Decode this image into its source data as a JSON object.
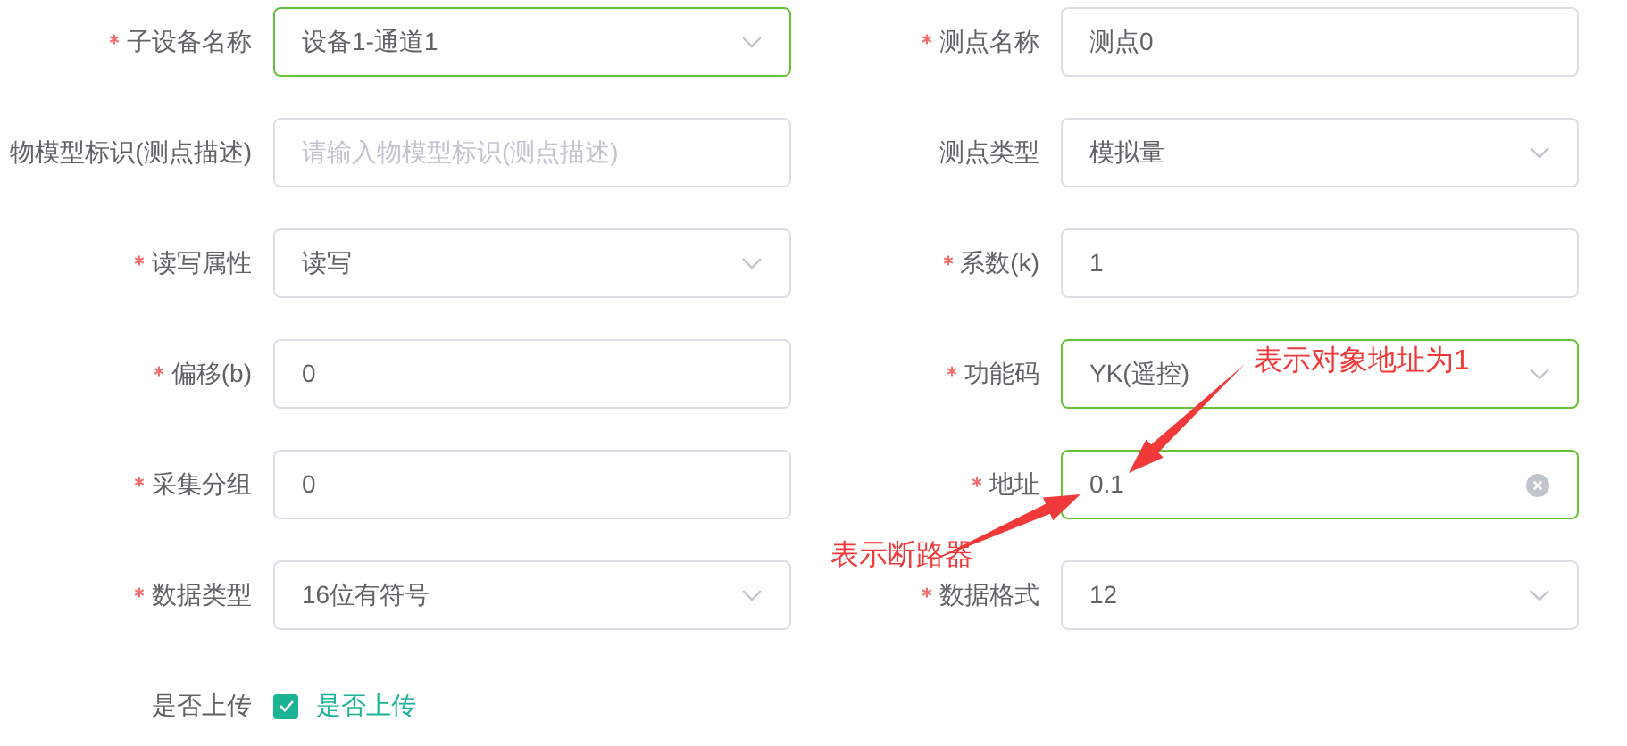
{
  "rows": [
    {
      "left": {
        "label": "子设备名称",
        "required": true,
        "kind": "select",
        "value": "设备1-通道1",
        "focused": true
      },
      "right": {
        "label": "测点名称",
        "required": true,
        "kind": "input",
        "value": "测点0",
        "focused": false
      }
    },
    {
      "left": {
        "label": "物模型标识(测点描述)",
        "required": false,
        "kind": "input",
        "placeholder": "请输入物模型标识(测点描述)",
        "focused": false
      },
      "right": {
        "label": "测点类型",
        "required": false,
        "kind": "select",
        "value": "模拟量",
        "focused": false
      }
    },
    {
      "left": {
        "label": "读写属性",
        "required": true,
        "kind": "select",
        "value": "读写",
        "focused": false
      },
      "right": {
        "label": "系数(k)",
        "required": true,
        "kind": "input",
        "value": "1",
        "focused": false
      }
    },
    {
      "left": {
        "label": "偏移(b)",
        "required": true,
        "kind": "input",
        "value": "0",
        "focused": false
      },
      "right": {
        "label": "功能码",
        "required": true,
        "kind": "select",
        "value": "YK(遥控)",
        "focused": true
      }
    },
    {
      "left": {
        "label": "采集分组",
        "required": true,
        "kind": "input",
        "value": "0",
        "focused": false
      },
      "right": {
        "label": "地址",
        "required": true,
        "kind": "clearable",
        "value": "0.1",
        "focused": true
      }
    },
    {
      "left": {
        "label": "数据类型",
        "required": true,
        "kind": "select",
        "value": "16位有符号",
        "focused": false
      },
      "right": {
        "label": "数据格式",
        "required": true,
        "kind": "select",
        "value": "12",
        "focused": false
      }
    }
  ],
  "upload": {
    "label": "是否上传",
    "checked": true,
    "option": "是否上传"
  },
  "annotations": [
    {
      "text": "表示对象地址为1"
    },
    {
      "text": "表示断路器"
    }
  ]
}
